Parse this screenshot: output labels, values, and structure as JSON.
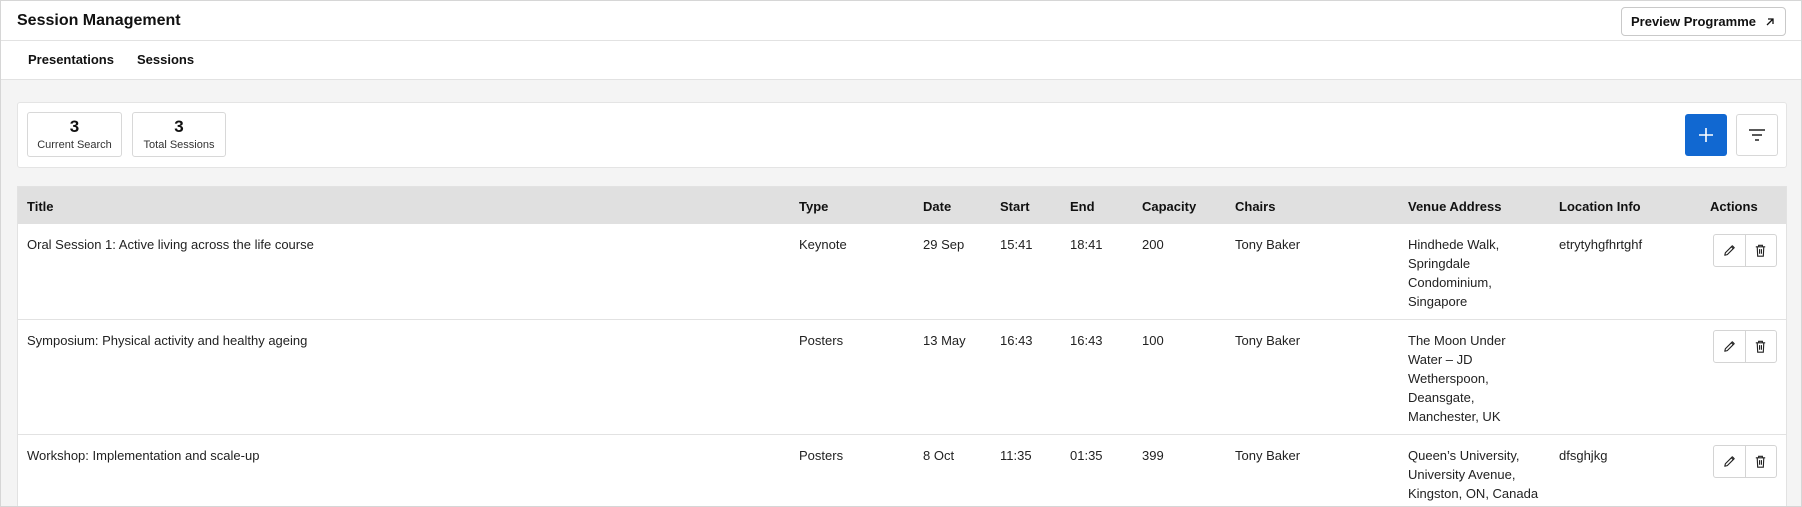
{
  "header": {
    "title": "Session Management",
    "preview_label": "Preview Programme",
    "preview_icon": "external-link-icon"
  },
  "tabs": [
    {
      "label": "Presentations"
    },
    {
      "label": "Sessions"
    }
  ],
  "stats": [
    {
      "value": "3",
      "label": "Current Search"
    },
    {
      "value": "3",
      "label": "Total Sessions"
    }
  ],
  "toolbar": {
    "add_icon": "plus-icon",
    "filter_icon": "filter-icon",
    "accent_color": "#1168d1"
  },
  "table": {
    "columns": [
      "Title",
      "Type",
      "Date",
      "Start",
      "End",
      "Capacity",
      "Chairs",
      "Venue Address",
      "Location Info",
      "Actions"
    ],
    "rows": [
      {
        "title": "Oral Session 1: Active living across the life course",
        "type": "Keynote",
        "date": "29 Sep",
        "start": "15:41",
        "end": "18:41",
        "capacity": "200",
        "chairs": "Tony Baker",
        "venue": [
          "Hindhede Walk,",
          "Springdale",
          "Condominium,",
          "Singapore"
        ],
        "location": "etrytyhgfhrtghf"
      },
      {
        "title": "Symposium: Physical activity and healthy ageing",
        "type": "Posters",
        "date": "13 May",
        "start": "16:43",
        "end": "16:43",
        "capacity": "100",
        "chairs": "Tony Baker",
        "venue": [
          "The Moon Under",
          "Water – JD",
          "Wetherspoon,",
          "Deansgate,",
          "Manchester, UK"
        ],
        "location": ""
      },
      {
        "title": "Workshop: Implementation and scale-up",
        "type": "Posters",
        "date": "8 Oct",
        "start": "11:35",
        "end": "01:35",
        "capacity": "399",
        "chairs": "Tony Baker",
        "venue": [
          "Queen’s University,",
          "University Avenue,",
          "Kingston, ON, Canada"
        ],
        "location": "dfsghjkg"
      }
    ]
  }
}
